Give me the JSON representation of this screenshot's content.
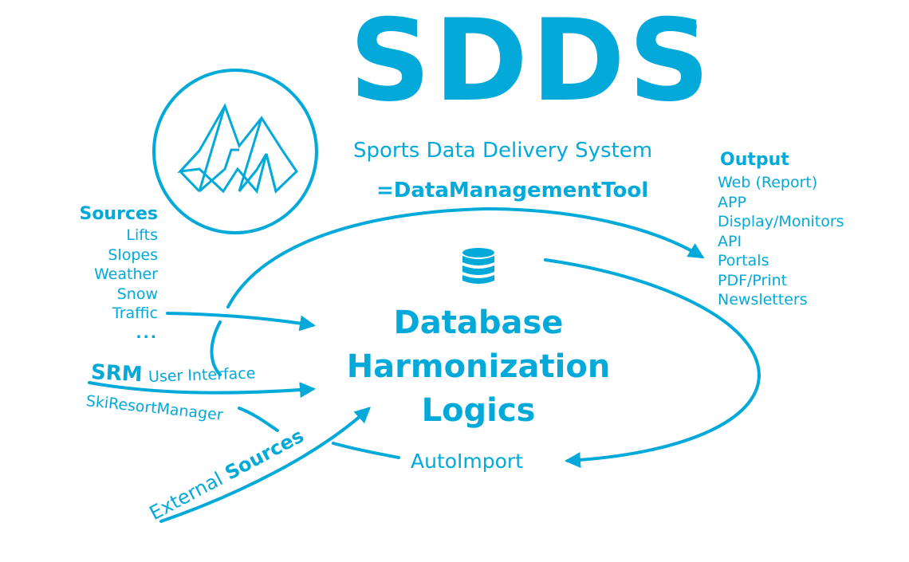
{
  "header": {
    "title": "SDDS",
    "trademark": "™",
    "subtitle": "Sports Data Delivery System",
    "tagline": "=DataManagementTool"
  },
  "sources": {
    "heading": "Sources",
    "items": [
      "Lifts",
      "Slopes",
      "Weather",
      "Snow",
      "Traffic",
      "..."
    ]
  },
  "srm": {
    "brand": "SRM",
    "label": "User Interface",
    "full_name": "SkiResortManager"
  },
  "external": {
    "prefix": "External",
    "suffix": "Sources"
  },
  "core": {
    "lines": [
      "Database",
      "Harmonization",
      "Logics"
    ]
  },
  "autoimport": "AutoImport",
  "output": {
    "heading": "Output",
    "items": [
      "Web (Report)",
      "APP",
      "Display/Monitors",
      "API",
      "Portals",
      "PDF/Print",
      "Newsletters"
    ]
  },
  "icons": {
    "logo": "mountain-logo-icon",
    "database": "database-icon"
  },
  "colors": {
    "brand": "#03a9d9",
    "background": "#ffffff"
  }
}
